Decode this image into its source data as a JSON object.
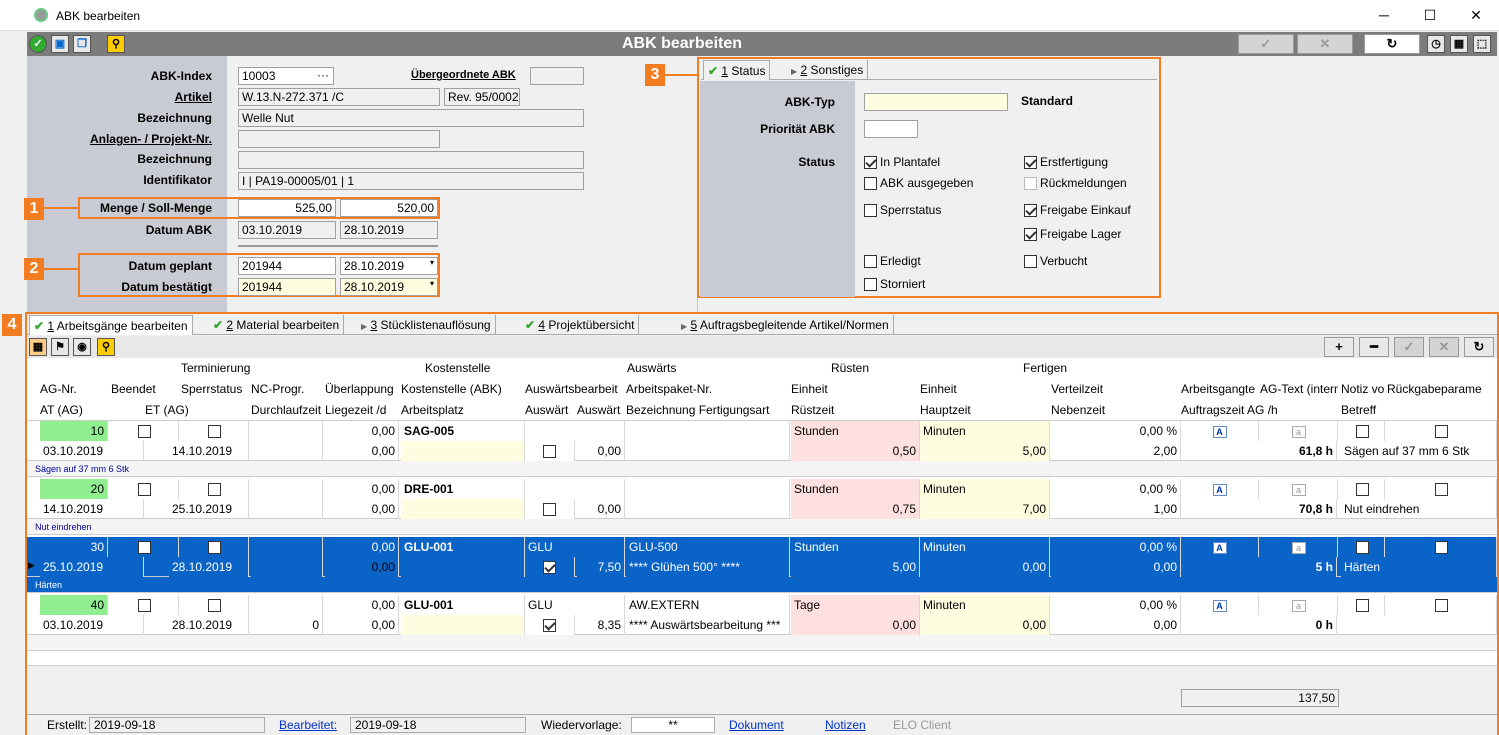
{
  "window": {
    "title": "ABK bearbeiten",
    "min": "─",
    "max": "☐",
    "close": "✕"
  },
  "toolbar": {
    "title": "ABK bearbeiten"
  },
  "form": {
    "abk_index_label": "ABK-Index",
    "abk_index": "10003",
    "abk_index_btn": "···",
    "uebergeordnete_label": "Übergeordnete ABK",
    "uebergeordnete": "",
    "artikel_label": "Artikel",
    "artikel": "W.13.N-272.371 /C",
    "rev": "Rev. 95/0002",
    "bezeichnung_label": "Bezeichnung",
    "bezeichnung": "Welle Nut",
    "anlagen_label": "Anlagen- / Projekt-Nr.",
    "anlagen": "",
    "bezeichnung2_label": "Bezeichnung",
    "bezeichnung2": "",
    "identifikator_label": "Identifikator",
    "identifikator": "I | PA19-00005/01 | 1",
    "menge_label": "Menge / Soll-Menge",
    "menge": "525,00",
    "soll_menge": "520,00",
    "datum_abk_label": "Datum ABK",
    "datum_abk1": "03.10.2019",
    "datum_abk2": "28.10.2019",
    "datum_geplant_label": "Datum geplant",
    "datum_geplant_kw": "201944",
    "datum_geplant": "28.10.2019",
    "datum_bestaetigt_label": "Datum bestätigt",
    "datum_bestaetigt_kw": "201944",
    "datum_bestaetigt": "28.10.2019"
  },
  "callouts": [
    "1",
    "2",
    "3",
    "4"
  ],
  "status_tabs": [
    {
      "num": "1",
      "label": " Status"
    },
    {
      "num": "2",
      "label": " Sonstiges"
    }
  ],
  "status": {
    "abk_typ_label": "ABK-Typ",
    "abk_typ": "",
    "abk_typ_value": "Standard",
    "prioritaet_label": "Priorität ABK",
    "prioritaet": "",
    "status_label": "Status",
    "checks": [
      {
        "label": "In Plantafel",
        "on": true
      },
      {
        "label": "Erstfertigung",
        "on": true
      },
      {
        "label": "ABK ausgegeben",
        "on": false
      },
      {
        "label": "Rückmeldungen",
        "on": false
      },
      {
        "label": "Sperrstatus",
        "on": false
      },
      {
        "label": "Freigabe Einkauf",
        "on": true
      },
      {
        "label": "Freigabe Lager",
        "on": true
      },
      {
        "label": "Erledigt",
        "on": false
      },
      {
        "label": "Verbucht",
        "on": false
      },
      {
        "label": "Storniert",
        "on": false
      }
    ]
  },
  "bottom_tabs": [
    {
      "num": "1",
      "label": " Arbeitsgänge bearbeiten"
    },
    {
      "num": "2",
      "label": " Material bearbeiten"
    },
    {
      "num": "3",
      "label": " Stücklistenauflösung"
    },
    {
      "num": "4",
      "label": " Projektübersicht"
    },
    {
      "num": "5",
      "label": " Auftragsbegleitende Artikel/Normen"
    }
  ],
  "grid_buttons": {
    "add": "+",
    "remove": "━"
  },
  "grid_headers": {
    "groups": [
      "Terminierung",
      "Kostenstelle",
      "Auswärts",
      "Rüsten",
      "Fertigen"
    ],
    "row1": [
      "AG-Nr.",
      "Beendet",
      "Sperrstatus",
      "NC-Progr.",
      "Überlappung",
      "Kostenstelle (ABK)",
      "Auswärtsbearbeit",
      "Arbeitspaket-Nr.",
      "Einheit",
      "Einheit",
      "Verteilzeit",
      "Arbeitsgangte",
      "AG-Text (intern",
      "Notiz vo",
      "Rückgabeparame"
    ],
    "row2": [
      "AT (AG)",
      "ET (AG)",
      "Durchlaufzeit",
      "Liegezeit /d",
      "Arbeitsplatz",
      "Auswärt",
      "Auswärt",
      "Bezeichnung Fertigungsart",
      "Rüstzeit",
      "Hauptzeit",
      "Nebenzeit",
      "Auftragszeit AG /h",
      "Betreff"
    ]
  },
  "rows": [
    {
      "ag": "10",
      "ueb": "0,00",
      "ks": "SAG-005",
      "aus": "",
      "ap": "",
      "r_einh": "Stunden",
      "f_einh": "Minuten",
      "vert": "0,00 %",
      "at": "03.10.2019",
      "et": "14.10.2019",
      "dl": "",
      "lz": "0,00",
      "apl": "",
      "aw_chk": false,
      "aw_val": "0,00",
      "bez": "",
      "ruest": "0,50",
      "haupt": "5,00",
      "neben": "2,00",
      "auftr": "61,8 h",
      "betreff": "Sägen auf 37 mm 6 Stk",
      "note": "Sägen auf 37 mm 6 Stk",
      "sel": false
    },
    {
      "ag": "20",
      "ueb": "0,00",
      "ks": "DRE-001",
      "aus": "",
      "ap": "",
      "r_einh": "Stunden",
      "f_einh": "Minuten",
      "vert": "0,00 %",
      "at": "14.10.2019",
      "et": "25.10.2019",
      "dl": "",
      "lz": "0,00",
      "apl": "",
      "aw_chk": false,
      "aw_val": "0,00",
      "bez": "",
      "ruest": "0,75",
      "haupt": "7,00",
      "neben": "1,00",
      "auftr": "70,8 h",
      "betreff": "Nut eindrehen",
      "note": "Nut eindrehen",
      "sel": false
    },
    {
      "ag": "30",
      "ueb": "0,00",
      "ks": "GLU-001",
      "aus": "GLU",
      "ap": "GLU-500",
      "r_einh": "Stunden",
      "f_einh": "Minuten",
      "vert": "0,00 %",
      "at": "25.10.2019",
      "et": "28.10.2019",
      "dl": "",
      "lz": "0,00",
      "apl": "",
      "aw_chk": true,
      "aw_val": "7,50",
      "bez": "**** Glühen 500° ****",
      "ruest": "5,00",
      "haupt": "0,00",
      "neben": "0,00",
      "auftr": "5 h",
      "betreff": "Härten",
      "note": "Härten",
      "sel": true
    },
    {
      "ag": "40",
      "ueb": "0,00",
      "ks": "GLU-001",
      "aus": "GLU",
      "ap": "AW.EXTERN",
      "r_einh": "Tage",
      "f_einh": "Minuten",
      "vert": "0,00 %",
      "at": "03.10.2019",
      "et": "28.10.2019",
      "dl": "0",
      "lz": "0,00",
      "apl": "",
      "aw_chk": true,
      "aw_val": "8,35",
      "bez": "**** Auswärtsbearbeitung ***",
      "ruest": "0,00",
      "haupt": "0,00",
      "neben": "0,00",
      "auftr": "0 h",
      "betreff": "",
      "note": "",
      "sel": false
    }
  ],
  "total": "137,50",
  "statusbar": {
    "erstellt_label": "Erstellt:",
    "erstellt": "2019-09-18",
    "bearbeitet_label": "Bearbeitet:",
    "bearbeitet": "2019-09-18",
    "wiedervorlage_label": "Wiedervorlage:",
    "wiedervorlage": "**",
    "dokument": "Dokument",
    "notizen": "Notizen",
    "elo": "ELO Client"
  }
}
